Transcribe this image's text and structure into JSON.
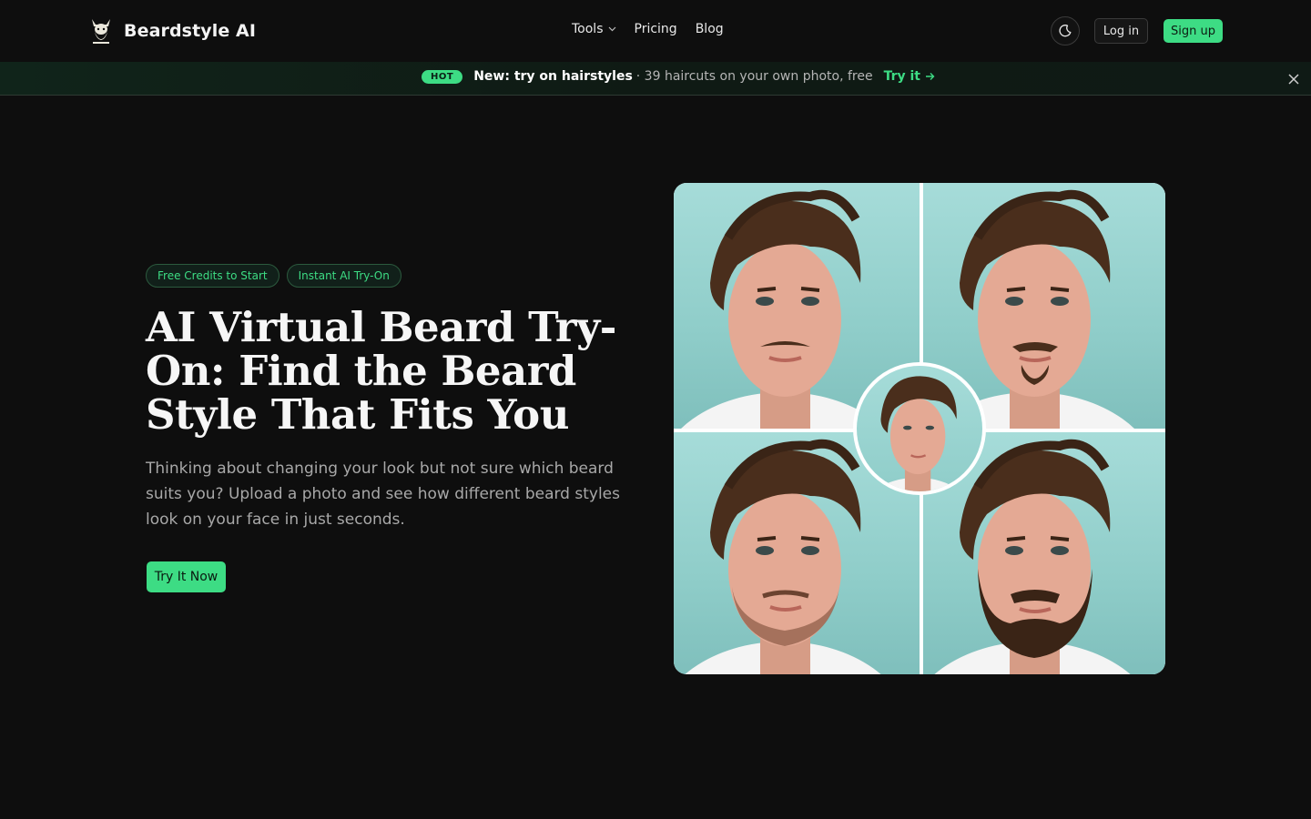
{
  "nav": {
    "brand": "Beardstyle AI",
    "links": [
      {
        "label": "Tools",
        "has_dropdown": true
      },
      {
        "label": "Pricing"
      },
      {
        "label": "Blog"
      }
    ],
    "theme_toggle_icon": "moon-icon",
    "login_label": "Log in",
    "signup_label": "Sign up"
  },
  "banner": {
    "badge": "HOT",
    "title": "New: try on hairstyles",
    "subtitle": "· 39 haircuts on your own photo, free",
    "cta": "Try it",
    "cta_icon": "arrow-right-icon",
    "close_icon": "close-icon"
  },
  "hero": {
    "badges": [
      "Free Credits to Start",
      "Instant AI Try-On"
    ],
    "title": "AI Virtual Beard Try-On: Find the Beard Style That Fits You",
    "subtitle": "Thinking about changing your look but not sure which beard suits you? Upload a photo and see how different beard styles look on your face in just seconds.",
    "cta": "Try It Now"
  },
  "collage": {
    "styles": [
      "mustache",
      "goatee",
      "stubble",
      "full-beard"
    ],
    "center": "clean-shaven"
  },
  "colors": {
    "background": "#0e0e0e",
    "accent": "#3ddc84",
    "photo_background": "#a6dcd9"
  }
}
